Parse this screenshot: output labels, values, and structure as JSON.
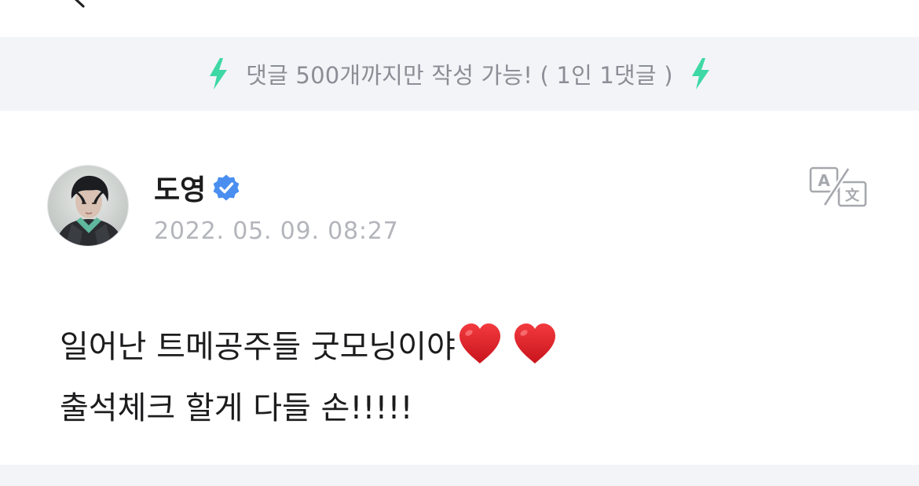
{
  "colors": {
    "accent_bolt": "#3ed8a4",
    "verified_badge": "#4a8ef0",
    "notice_background": "#f3f4f8",
    "heart": "#e8222b"
  },
  "header": {
    "back_icon": "chevron-left-icon"
  },
  "notice": {
    "text": "댓글 500개까지만 작성 가능! ( 1인 1댓글 )",
    "left_icon": "lightning-bolt-icon",
    "right_icon": "lightning-bolt-icon"
  },
  "post": {
    "author": {
      "name": "도영",
      "verified": true,
      "avatar_icon": "user-avatar"
    },
    "timestamp": "2022. 05. 09. 08:27",
    "translate_icon": "translate-icon",
    "body": {
      "line1": "일어난 트메공주들 굿모닝이야",
      "line2": "출석체크 할게 다들 손!!!!!",
      "emoji": [
        "heart-icon",
        "heart-icon"
      ]
    }
  }
}
